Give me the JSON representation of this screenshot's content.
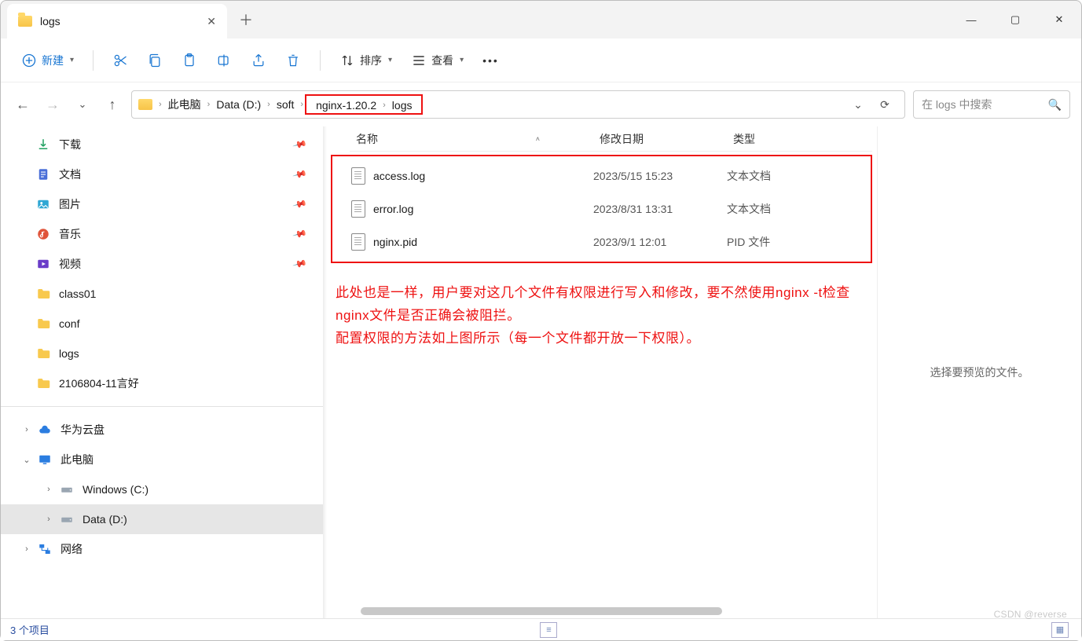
{
  "window": {
    "tab_title": "logs"
  },
  "toolbar": {
    "new_label": "新建",
    "sort_label": "排序",
    "view_label": "查看"
  },
  "breadcrumb": {
    "items": [
      "此电脑",
      "Data (D:)",
      "soft",
      "nginx-1.20.2",
      "logs"
    ],
    "highlight_start": 3
  },
  "search": {
    "placeholder": "在 logs 中搜索"
  },
  "sidebar": {
    "quick": [
      {
        "label": "下载",
        "icon": "download-icon"
      },
      {
        "label": "文档",
        "icon": "document-icon"
      },
      {
        "label": "图片",
        "icon": "picture-icon"
      },
      {
        "label": "音乐",
        "icon": "music-icon"
      },
      {
        "label": "视频",
        "icon": "video-icon"
      },
      {
        "label": "class01",
        "icon": "folder-icon"
      },
      {
        "label": "conf",
        "icon": "folder-icon"
      },
      {
        "label": "logs",
        "icon": "folder-icon"
      },
      {
        "label": "2106804-11言好",
        "icon": "folder-icon"
      }
    ],
    "tree": [
      {
        "label": "华为云盘",
        "icon": "cloud-icon",
        "expand": "›",
        "indent": 0
      },
      {
        "label": "此电脑",
        "icon": "pc-icon",
        "expand": "⌄",
        "indent": 0
      },
      {
        "label": "Windows (C:)",
        "icon": "drive-icon",
        "expand": "›",
        "indent": 1
      },
      {
        "label": "Data (D:)",
        "icon": "drive-icon",
        "expand": "›",
        "indent": 1,
        "selected": true
      },
      {
        "label": "网络",
        "icon": "network-icon",
        "expand": "›",
        "indent": 0
      }
    ]
  },
  "columns": {
    "name": "名称",
    "date": "修改日期",
    "type": "类型"
  },
  "files": [
    {
      "name": "access.log",
      "date": "2023/5/15 15:23",
      "type": "文本文档"
    },
    {
      "name": "error.log",
      "date": "2023/8/31 13:31",
      "type": "文本文档"
    },
    {
      "name": "nginx.pid",
      "date": "2023/9/1 12:01",
      "type": "PID 文件"
    }
  ],
  "annotation": "此处也是一样，用户要对这几个文件有权限进行写入和修改，要不然使用nginx -t检查nginx文件是否正确会被阻拦。\n配置权限的方法如上图所示（每一个文件都开放一下权限）。",
  "preview": {
    "empty_text": "选择要预览的文件。"
  },
  "status": {
    "text": "3 个项目"
  },
  "watermark": "CSDN @reverse"
}
